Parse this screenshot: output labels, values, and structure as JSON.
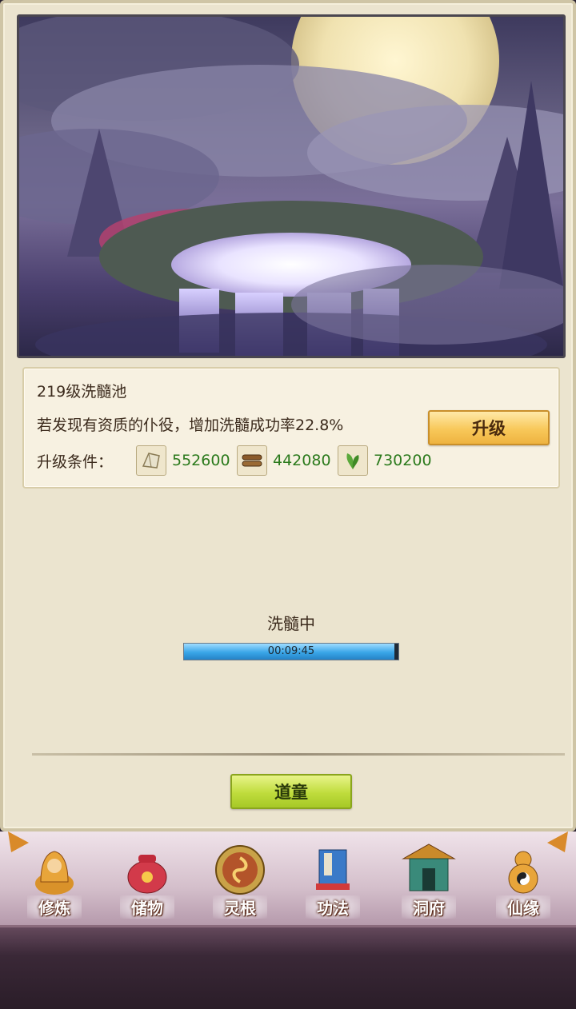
{
  "info": {
    "title": "219级洗髓池",
    "description": "若发现有资质的仆役，增加洗髓成功率22.8%",
    "requirement_label": "升级条件：",
    "requirements": [
      {
        "icon": "jade-stone-icon",
        "value": "552600"
      },
      {
        "icon": "wood-logs-icon",
        "value": "442080"
      },
      {
        "icon": "herb-leaf-icon",
        "value": "730200"
      }
    ],
    "upgrade_label": "升级"
  },
  "status": {
    "label": "洗髓中",
    "progress": 0.98,
    "timer": "00:09:45"
  },
  "action_label": "道童",
  "nav": {
    "items": [
      {
        "label": "修炼",
        "icon": "monk-icon"
      },
      {
        "label": "储物",
        "icon": "treasure-bag-icon"
      },
      {
        "label": "灵根",
        "icon": "spirit-root-icon"
      },
      {
        "label": "功法",
        "icon": "scripture-book-icon"
      },
      {
        "label": "洞府",
        "icon": "cave-mansion-icon"
      },
      {
        "label": "仙缘",
        "icon": "gourd-icon"
      }
    ]
  },
  "colors": {
    "panel_bg": "#ebe4cf",
    "req_value": "#2b7a1c",
    "upgrade_btn": "#f8c85a",
    "action_btn": "#bfdc3c",
    "progress_fill": "#3aa6e8"
  }
}
